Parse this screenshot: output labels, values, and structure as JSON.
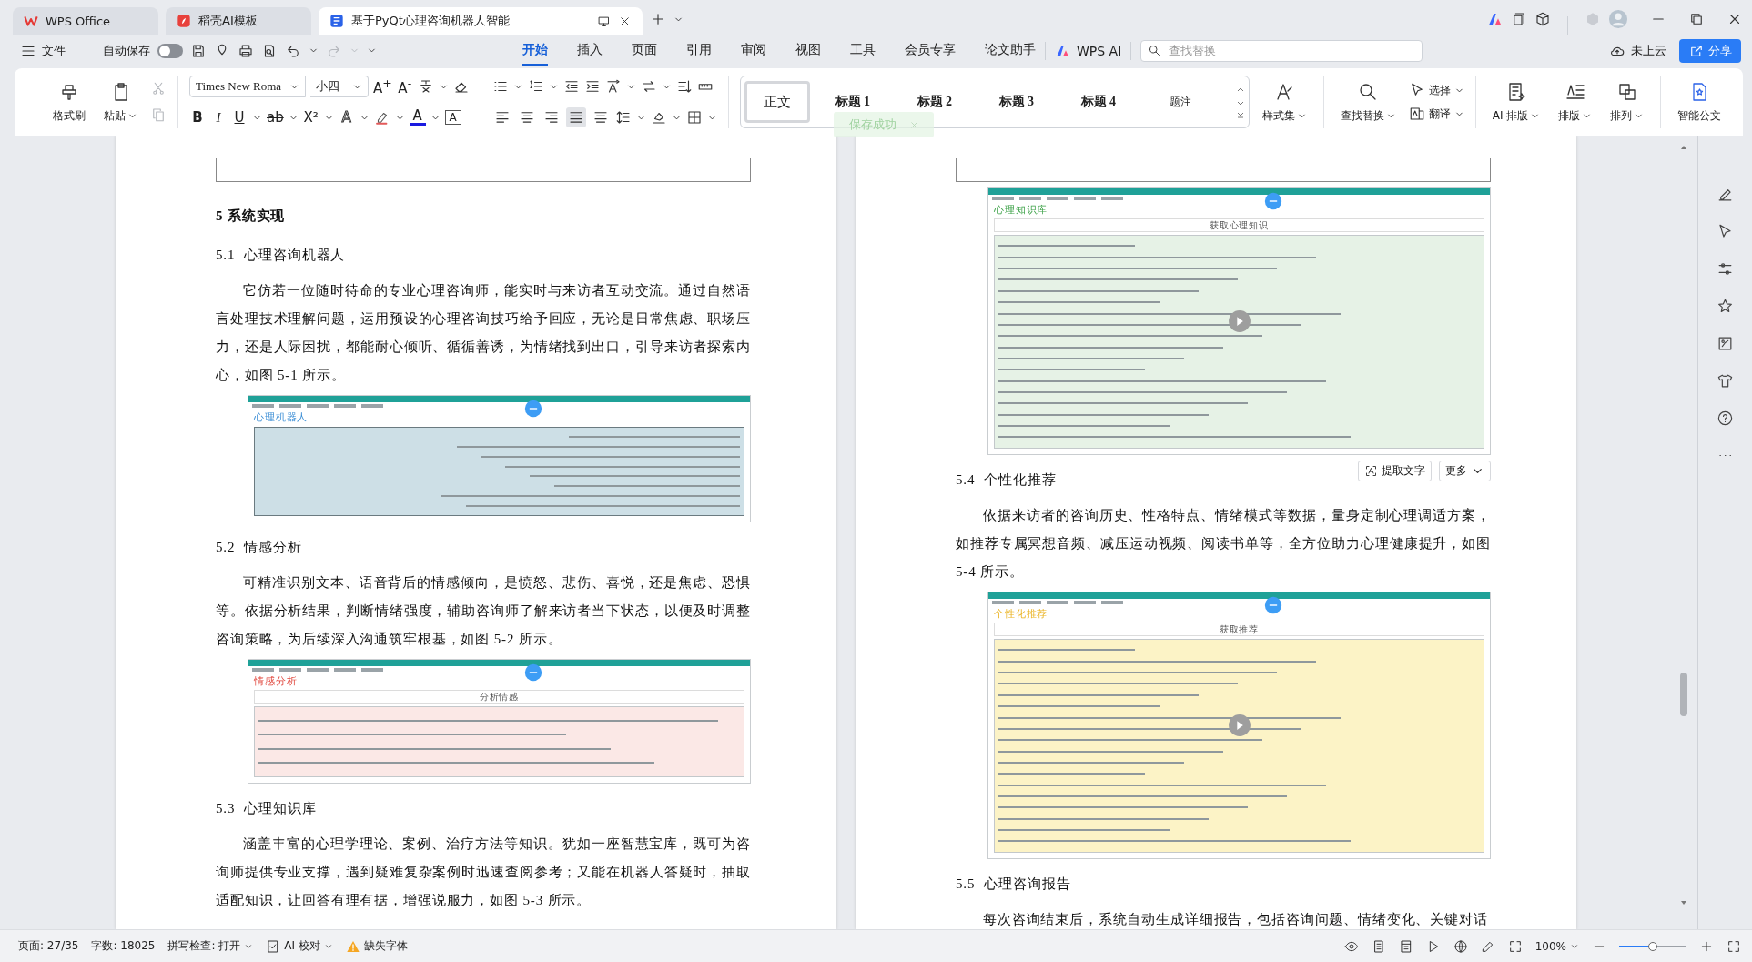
{
  "tabs": [
    {
      "label": "WPS Office",
      "kind": "wps",
      "selected": false
    },
    {
      "label": "稻壳AI模板",
      "kind": "docer",
      "selected": false
    },
    {
      "label": "基于PyQt心理咨询机器人智能",
      "kind": "doc",
      "selected": true
    }
  ],
  "menu": {
    "file": "文件",
    "autosave": {
      "label": "自动保存",
      "on": false
    },
    "items": [
      {
        "label": "开始",
        "selected": true
      },
      {
        "label": "插入",
        "selected": false
      },
      {
        "label": "页面",
        "selected": false
      },
      {
        "label": "引用",
        "selected": false
      },
      {
        "label": "审阅",
        "selected": false
      },
      {
        "label": "视图",
        "selected": false
      },
      {
        "label": "工具",
        "selected": false
      },
      {
        "label": "会员专享",
        "selected": false
      },
      {
        "label": "论文助手",
        "selected": false
      }
    ],
    "ai": "WPS AI",
    "search_placeholder": "查找替换",
    "cloud": "未上云",
    "share": "分享"
  },
  "ribbon": {
    "format_painter": "格式刷",
    "paste": "粘贴",
    "font": "Times New Roma",
    "size": "小四",
    "size_buttons": [
      "A$^{+}$",
      "A$^{-}$"
    ],
    "format": [
      {
        "glyph": "B",
        "kind": "bold",
        "caret": false
      },
      {
        "glyph": "I",
        "kind": "italic",
        "caret": false
      },
      {
        "glyph": "U",
        "kind": "underline",
        "caret": true
      },
      {
        "glyph": "ab",
        "kind": "strike",
        "caret": true
      },
      {
        "glyph": "X²",
        "kind": "super",
        "caret": true
      },
      {
        "glyph": "A",
        "kind": "effect",
        "caret": true
      },
      {
        "kind": "highlight",
        "caret": true
      },
      {
        "glyph": "A",
        "kind": "color",
        "caret": true
      },
      {
        "glyph": "A",
        "kind": "boxed",
        "caret": false
      }
    ],
    "align": [
      {
        "kind": "left",
        "selected": false
      },
      {
        "kind": "center",
        "selected": false
      },
      {
        "kind": "right",
        "selected": false
      },
      {
        "kind": "justify",
        "selected": true
      },
      {
        "kind": "distributed",
        "selected": false
      }
    ],
    "styles": [
      {
        "label": "正文",
        "kind": "body",
        "selected": true
      },
      {
        "label": "标题 1",
        "kind": "heading",
        "selected": false
      },
      {
        "label": "标题 2",
        "kind": "heading",
        "selected": false
      },
      {
        "label": "标题 3",
        "kind": "heading",
        "selected": false
      },
      {
        "label": "标题 4",
        "kind": "heading",
        "selected": false
      },
      {
        "label": "题注",
        "kind": "caption",
        "selected": false
      }
    ],
    "style_set": {
      "label": "样式集",
      "kind": "styleset",
      "caret": true
    },
    "find": {
      "label": "查找替换",
      "kind": "find",
      "caret": true
    },
    "small_tools": [
      {
        "label": "选择",
        "kind": "select",
        "caret": true
      },
      {
        "label": "翻译",
        "kind": "translate",
        "caret": true
      }
    ],
    "layout_tools": [
      {
        "label": "AI 排版",
        "kind": "ai_layout",
        "caret": true
      },
      {
        "label": "排版",
        "kind": "layout",
        "caret": true
      },
      {
        "label": "排列",
        "kind": "arrange",
        "caret": true
      }
    ],
    "smart_doc": {
      "label": "智能公文",
      "kind": "smart_doc",
      "caret": false
    }
  },
  "toast": {
    "text": "保存成功"
  },
  "pages": [
    {
      "blocks": [
        {
          "kind": "heading1",
          "text": "5 系统实现"
        },
        {
          "kind": "heading2",
          "number": "5.1",
          "text": "心理咨询机器人"
        },
        {
          "kind": "para",
          "text": "它仿若一位随时待命的专业心理咨询师，能实时与来访者互动交流。通过自然语言处理技术理解问题，运用预设的心理咨询技巧给予回应，无论是日常焦虑、职场压力，还是人际困扰，都能耐心倾听、循循善诱，为情绪找到出口，引导来访者探索内心，如图 5-1 所示。"
        },
        {
          "kind": "chat",
          "title": "心理机器人",
          "video": false
        },
        {
          "kind": "heading2",
          "number": "5.2",
          "text": "情感分析"
        },
        {
          "kind": "para",
          "text": "可精准识别文本、语音背后的情感倾向，是愤怒、悲伤、喜悦，还是焦虑、恐惧等。依据分析结果，判断情绪强度，辅助咨询师了解来访者当下状态，以便及时调整咨询策略，为后续深入沟通筑牢根基，如图 5-2 所示。"
        },
        {
          "kind": "analysis",
          "title": "情感分析",
          "button": "分析情感",
          "video": false
        },
        {
          "kind": "heading2",
          "number": "5.3",
          "text": "心理知识库"
        },
        {
          "kind": "para",
          "text": "涵盖丰富的心理学理论、案例、治疗方法等知识。犹如一座智慧宝库，既可为咨询师提供专业支撑，遇到疑难复杂案例时迅速查阅参考；又能在机器人答疑时，抽取适配知识，让回答有理有据，增强说服力，如图 5-3 所示。"
        }
      ]
    },
    {
      "blocks": [
        {
          "kind": "knowledge",
          "title": "心理知识库",
          "button": "获取心理知识",
          "video": true,
          "tools": {
            "extract": "提取文字",
            "more": "更多"
          }
        },
        {
          "kind": "heading2",
          "number": "5.4",
          "text": "个性化推荐"
        },
        {
          "kind": "para",
          "text": "依据来访者的咨询历史、性格特点、情绪模式等数据，量身定制心理调适方案，如推荐专属冥想音频、减压运动视频、阅读书单等，全方位助力心理健康提升，如图 5-4 所示。"
        },
        {
          "kind": "recommend",
          "title": "个性化推荐",
          "button": "获取推荐",
          "video": true
        },
        {
          "kind": "heading2",
          "number": "5.5",
          "text": "心理咨询报告"
        },
        {
          "kind": "para",
          "text": "每次咨询结束后，系统自动生成详细报告，包括咨询问题、情绪变化、关键对话"
        }
      ]
    }
  ],
  "status": {
    "items": [
      {
        "text": "页面: 27/35",
        "kind": "plain"
      },
      {
        "text": "字数: 18025",
        "kind": "plain"
      },
      {
        "text": "拼写检查: 打开",
        "kind": "dropdown"
      },
      {
        "text": "AI 校对",
        "kind": "ai"
      },
      {
        "text": "缺失字体",
        "kind": "warning"
      }
    ],
    "zoom": "100%",
    "zoom_slider": {
      "level": 0.5
    }
  }
}
